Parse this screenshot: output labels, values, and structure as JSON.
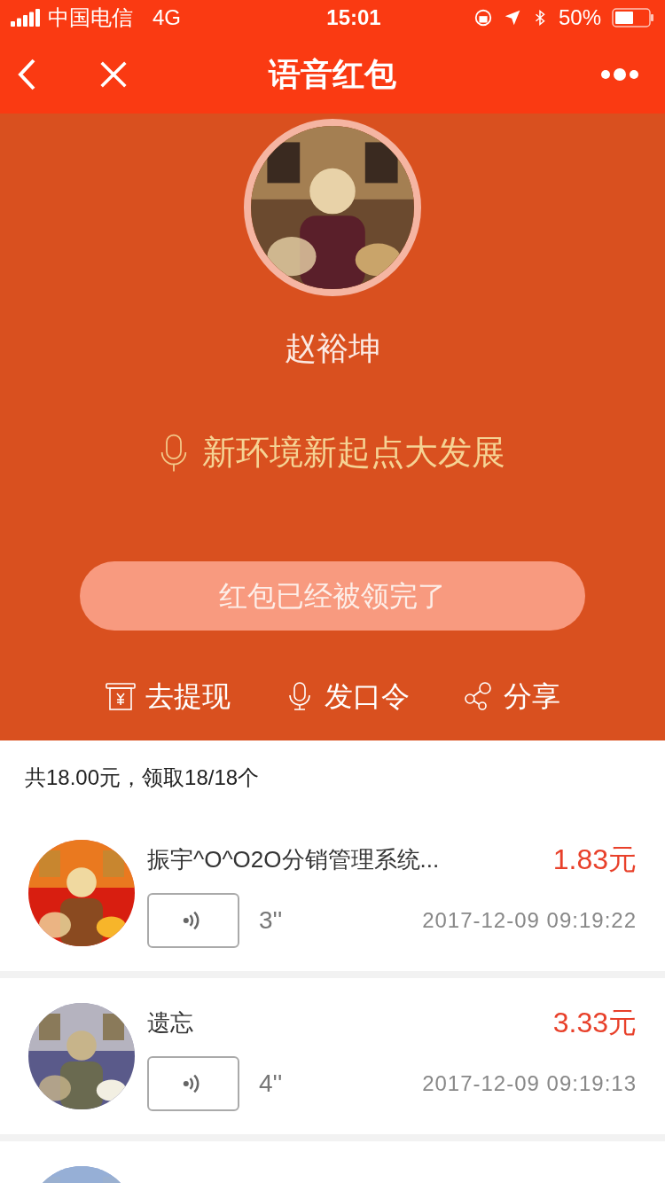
{
  "status_bar": {
    "carrier": "中国电信",
    "network": "4G",
    "time": "15:01",
    "battery": "50%"
  },
  "nav": {
    "title": "语音红包"
  },
  "profile": {
    "avatar": {
      "kind": "picture"
    },
    "name": "赵裕坤",
    "voice_message": "新环境新起点大发展"
  },
  "status_button": {
    "label": "红包已经被领完了",
    "disabled": true
  },
  "actions": [
    {
      "kind": "withdraw",
      "label": "去提现"
    },
    {
      "kind": "voice",
      "label": "发口令"
    },
    {
      "kind": "share",
      "label": "分享"
    }
  ],
  "summary": "共18.00元，领取18/18个",
  "records": [
    {
      "avatar": {
        "kind": "picture"
      },
      "name": "振宇^O^O2O分销管理系统...",
      "amount": "1.83元",
      "duration": "3''",
      "time": "2017-12-09 09:19:22"
    },
    {
      "avatar": {
        "kind": "picture"
      },
      "name": "遗忘",
      "amount": "3.33元",
      "duration": "4''",
      "time": "2017-12-09 09:19:13"
    },
    {
      "avatar": {
        "kind": "picture"
      }
    }
  ]
}
